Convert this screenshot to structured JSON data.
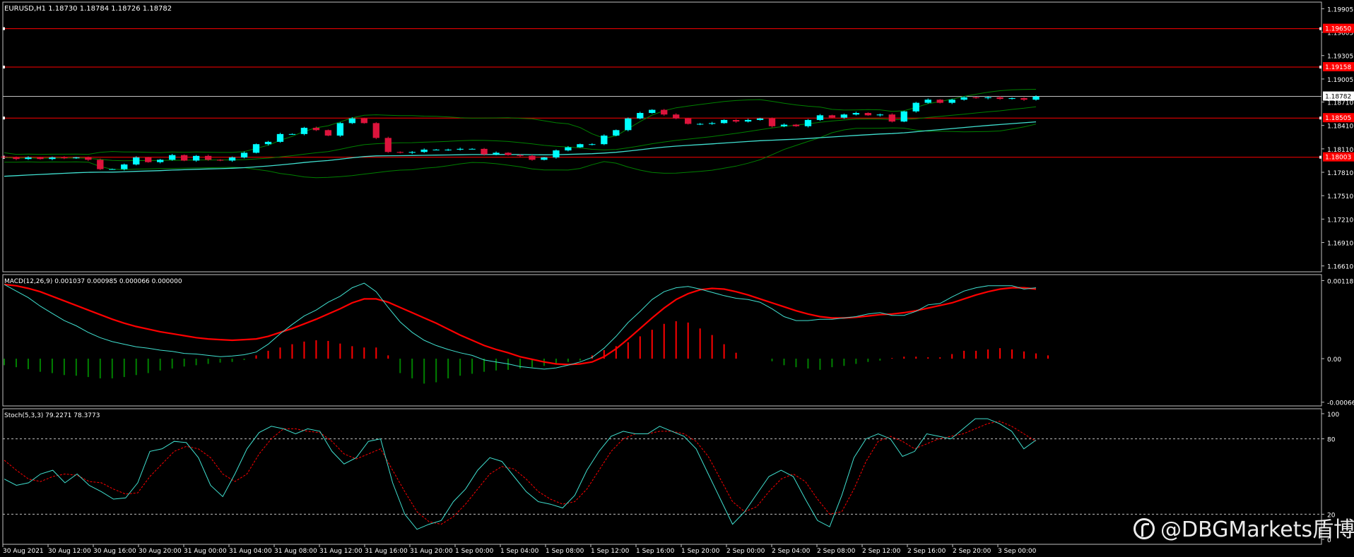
{
  "chart_data": {
    "type": "candlestick",
    "symbol_header": "EURUSD,H1  1.18730 1.18784 1.18726 1.18782",
    "colors": {
      "background": "#000000",
      "frame": "#c0c0c0",
      "bull": "#00ffff",
      "bear": "#dc143c",
      "level_line": "#ff0000",
      "bb": "#008000",
      "ma": "#40e0d0",
      "text": "#ffffff",
      "macd_line": "#ff0000",
      "macd_signal": "#40e0d0",
      "hist_pos": "#ff0000",
      "hist_neg": "#008000",
      "stoch_main": "#40e0d0",
      "stoch_signal": "#ff0000"
    },
    "price_ticks": [
      "1.19905",
      "1.19605",
      "1.19305",
      "1.19005",
      "1.18710",
      "1.18410",
      "1.18110",
      "1.17810",
      "1.17510",
      "1.17210",
      "1.16910",
      "1.16610"
    ],
    "ylim": [
      1.16535,
      1.1999
    ],
    "level_lines": [
      {
        "value": 1.1965,
        "label": "1.19650"
      },
      {
        "value": 1.19158,
        "label": "1.19158"
      },
      {
        "value": 1.18505,
        "label": "1.18505"
      },
      {
        "value": 1.18003,
        "label": "1.18003"
      }
    ],
    "current_price": {
      "value": 1.18782,
      "label": "1.18782"
    },
    "x_labels": [
      "30 Aug 2021",
      "30 Aug 12:00",
      "30 Aug 16:00",
      "30 Aug 20:00",
      "31 Aug 00:00",
      "31 Aug 04:00",
      "31 Aug 08:00",
      "31 Aug 12:00",
      "31 Aug 16:00",
      "31 Aug 20:00",
      "1 Sep 00:00",
      "1 Sep 04:00",
      "1 Sep 08:00",
      "1 Sep 12:00",
      "1 Sep 16:00",
      "1 Sep 20:00",
      "2 Sep 00:00",
      "2 Sep 04:00",
      "2 Sep 08:00",
      "2 Sep 12:00",
      "2 Sep 16:00",
      "2 Sep 20:00",
      "3 Sep 00:00"
    ],
    "close": [
      1.18,
      1.1798,
      1.18,
      1.1798,
      1.18,
      1.1799,
      1.18,
      1.1797,
      1.1785,
      1.1785,
      1.1791,
      1.18,
      1.1794,
      1.1797,
      1.1803,
      1.1796,
      1.1802,
      1.1797,
      1.1796,
      1.18,
      1.1806,
      1.1817,
      1.182,
      1.183,
      1.183,
      1.1838,
      1.1835,
      1.1828,
      1.1844,
      1.185,
      1.1844,
      1.1825,
      1.1807,
      1.1806,
      1.1807,
      1.181,
      1.181,
      1.181,
      1.1811,
      1.1811,
      1.1804,
      1.1806,
      1.1803,
      1.1802,
      1.1797,
      1.18,
      1.1809,
      1.1813,
      1.1817,
      1.1817,
      1.1828,
      1.1835,
      1.185,
      1.1857,
      1.1861,
      1.1855,
      1.185,
      1.1843,
      1.1843,
      1.1844,
      1.1848,
      1.1846,
      1.1848,
      1.185,
      1.184,
      1.1842,
      1.184,
      1.1848,
      1.1854,
      1.1851,
      1.1855,
      1.1857,
      1.1854,
      1.1855,
      1.1846,
      1.1859,
      1.187,
      1.1874,
      1.187,
      1.1874,
      1.1877,
      1.1876,
      1.1877,
      1.1875,
      1.1876,
      1.1874,
      1.1878
    ],
    "open_prev_close": true,
    "indicator_labels": [
      "Bollinger Bands",
      "Moving Average"
    ],
    "macd": {
      "label": "MACD(12,26,9) 0.001037 0.000985 0.000066 0.000000",
      "ticks": [
        "0.001189",
        "0.00",
        "-0.000663"
      ],
      "ylim": [
        -0.00072,
        0.00128
      ],
      "main": [
        0.00113,
        0.00103,
        0.00093,
        0.0008,
        0.00069,
        0.00058,
        0.0005,
        0.0004,
        0.00032,
        0.00026,
        0.00022,
        0.00018,
        0.00016,
        0.00013,
        0.00011,
        8e-05,
        7e-05,
        5e-05,
        3e-05,
        4e-05,
        6e-05,
        0.0001,
        0.00022,
        0.00038,
        0.00052,
        0.00065,
        0.00074,
        0.00086,
        0.00095,
        0.00108,
        0.00115,
        0.00102,
        0.00078,
        0.00056,
        0.0004,
        0.00028,
        0.0002,
        0.00014,
        9e-05,
        5e-05,
        -2e-05,
        -5e-05,
        -8e-05,
        -0.00012,
        -0.00014,
        -0.00016,
        -0.00014,
        -0.0001,
        -5e-05,
        2e-05,
        0.00016,
        0.00034,
        0.00055,
        0.00072,
        0.0009,
        0.00102,
        0.00108,
        0.0011,
        0.00106,
        0.00101,
        0.00096,
        0.00092,
        0.0009,
        0.00086,
        0.00076,
        0.00064,
        0.00058,
        0.00058,
        0.0006,
        0.0006,
        0.00062,
        0.00064,
        0.00068,
        0.0007,
        0.00066,
        0.00066,
        0.00072,
        0.00082,
        0.00084,
        0.00094,
        0.00103,
        0.00108,
        0.00111,
        0.00111,
        0.00111,
        0.00106,
        0.00108
      ],
      "signal": [
        0.00113,
        0.00111,
        0.00107,
        0.00102,
        0.00095,
        0.00088,
        0.00081,
        0.00074,
        0.00067,
        0.0006,
        0.00054,
        0.00049,
        0.00045,
        0.00041,
        0.00038,
        0.00035,
        0.00032,
        0.0003,
        0.00029,
        0.00028,
        0.00029,
        0.0003,
        0.00034,
        0.0004,
        0.00046,
        0.00053,
        0.0006,
        0.00068,
        0.00076,
        0.00085,
        0.00091,
        0.00091,
        0.00086,
        0.00078,
        0.0007,
        0.00062,
        0.00054,
        0.00045,
        0.00036,
        0.00028,
        0.0002,
        0.00014,
        9e-05,
        3e-05,
        -1e-05,
        -5e-05,
        -8e-05,
        -9e-05,
        -8e-05,
        -5e-05,
        3e-05,
        0.00015,
        0.0003,
        0.00046,
        0.00062,
        0.00077,
        0.0009,
        0.00099,
        0.00105,
        0.00107,
        0.00106,
        0.00102,
        0.00097,
        0.00091,
        0.00085,
        0.00079,
        0.00073,
        0.00068,
        0.00064,
        0.00062,
        0.00062,
        0.00063,
        0.00065,
        0.00067,
        0.00068,
        0.0007,
        0.00073,
        0.00077,
        0.00081,
        0.00085,
        0.00091,
        0.00097,
        0.00102,
        0.00106,
        0.00108,
        0.00108,
        0.00106
      ],
      "hist": [
        -0.0001,
        -0.00013,
        -0.00016,
        -0.0002,
        -0.00022,
        -0.00025,
        -0.00026,
        -0.00028,
        -0.0003,
        -0.0003,
        -0.00028,
        -0.00025,
        -0.00022,
        -0.00018,
        -0.00015,
        -0.00012,
        -0.0001,
        -8e-05,
        -6e-05,
        -5e-05,
        -2e-05,
        5e-05,
        0.00012,
        0.00017,
        0.00022,
        0.00026,
        0.00028,
        0.00027,
        0.00023,
        0.00019,
        0.00017,
        0.00017,
        5e-05,
        -0.00022,
        -0.0003,
        -0.00038,
        -0.00036,
        -0.0003,
        -0.00026,
        -0.00023,
        -0.0002,
        -0.00018,
        -0.00017,
        -0.00015,
        -0.00013,
        -0.00011,
        -8e-05,
        -5e-05,
        -3e-05,
        5e-05,
        0.00013,
        0.00019,
        0.00025,
        0.00034,
        0.00044,
        0.00053,
        0.00057,
        0.00055,
        0.00046,
        0.00036,
        0.00022,
        9e-05,
        0.0,
        0.0,
        -4e-05,
        -0.0001,
        -0.00013,
        -0.00015,
        -0.00017,
        -0.00013,
        -0.00011,
        -8e-05,
        -5e-05,
        -3e-05,
        1e-05,
        3e-05,
        3e-05,
        2e-05,
        2e-05,
        7e-05,
        0.00012,
        0.00012,
        0.00014,
        0.00016,
        0.00014,
        0.00011,
        8e-05,
        5e-05
      ]
    },
    "stoch": {
      "label": "Stoch(5,3,3) 79.2271 78.3773",
      "ticks": [
        "100",
        "80",
        "20",
        "0"
      ],
      "ylim": [
        0,
        100
      ],
      "levels": [
        20,
        80
      ],
      "main": [
        48,
        43,
        45,
        52,
        55,
        45,
        52,
        43,
        38,
        32,
        33,
        45,
        70,
        72,
        78,
        77,
        65,
        43,
        34,
        52,
        72,
        85,
        90,
        88,
        84,
        88,
        86,
        70,
        60,
        65,
        78,
        80,
        45,
        20,
        8,
        12,
        15,
        30,
        40,
        55,
        65,
        62,
        50,
        38,
        30,
        28,
        25,
        35,
        55,
        70,
        82,
        86,
        84,
        84,
        90,
        86,
        82,
        72,
        52,
        32,
        12,
        22,
        36,
        50,
        55,
        50,
        32,
        15,
        10,
        35,
        65,
        80,
        84,
        80,
        66,
        70,
        84,
        82,
        80,
        88,
        96,
        96,
        92,
        86,
        72,
        79
      ],
      "signal": [
        63,
        55,
        48,
        46,
        50,
        52,
        51,
        46,
        45,
        40,
        36,
        37,
        50,
        60,
        70,
        74,
        72,
        65,
        52,
        46,
        52,
        68,
        80,
        88,
        88,
        86,
        85,
        78,
        68,
        64,
        68,
        72,
        55,
        38,
        22,
        14,
        12,
        18,
        28,
        40,
        52,
        58,
        56,
        48,
        38,
        32,
        28,
        30,
        40,
        55,
        70,
        80,
        84,
        84,
        86,
        86,
        84,
        78,
        66,
        48,
        30,
        22,
        26,
        38,
        48,
        52,
        46,
        32,
        20,
        22,
        40,
        62,
        78,
        82,
        78,
        72,
        76,
        80,
        82,
        84,
        88,
        92,
        94,
        90,
        84,
        78
      ]
    }
  },
  "watermark": {
    "text": "@DBGMarkets盾博",
    "icon": "dbg-logo-icon"
  }
}
